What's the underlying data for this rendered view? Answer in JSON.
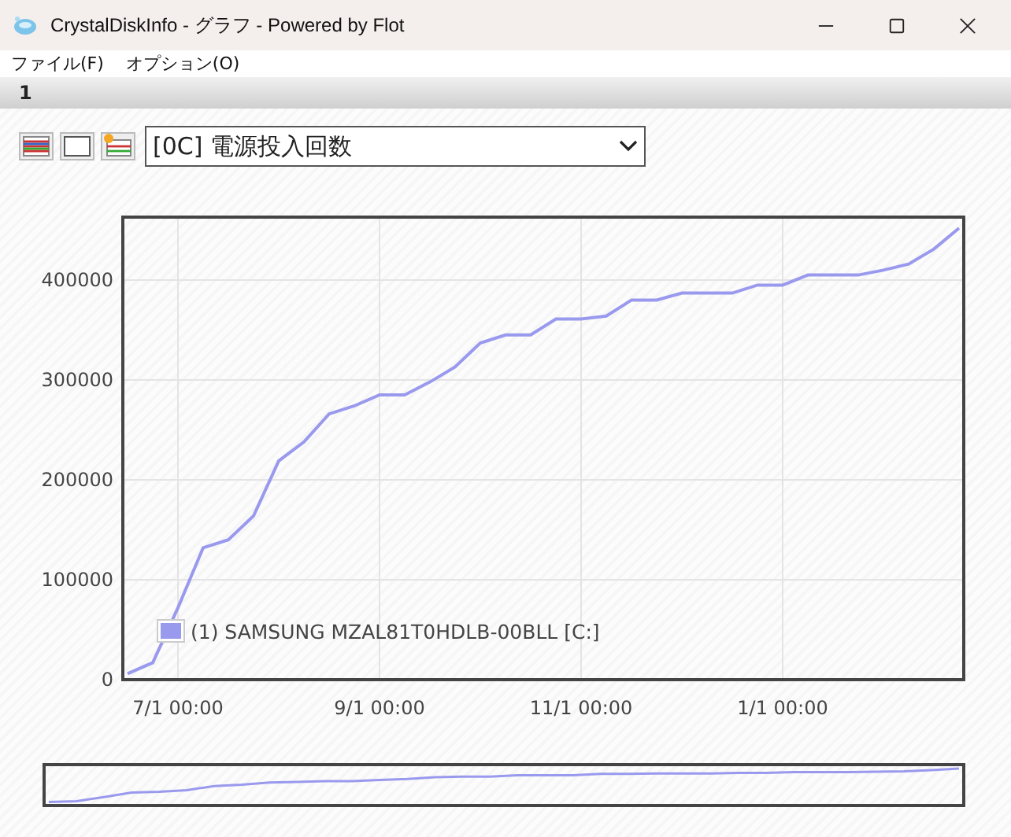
{
  "window": {
    "title": "CrystalDiskInfo - グラフ - Powered by Flot"
  },
  "menu": [
    {
      "label": "ファイル(F)"
    },
    {
      "label": "オプション(O)"
    }
  ],
  "tabs": [
    {
      "label": "1",
      "selected": true
    }
  ],
  "toolbar": {
    "attribute": "[0C] 電源投入回数"
  },
  "chart_data": {
    "type": "line",
    "categories": [
      null,
      null,
      "7/1 00:00",
      null,
      null,
      null,
      null,
      null,
      null,
      null,
      "9/1 00:00",
      null,
      null,
      null,
      null,
      null,
      null,
      null,
      "11/1 00:00",
      null,
      null,
      null,
      null,
      null,
      null,
      null,
      "1/1 00:00",
      null,
      null,
      null,
      null,
      null,
      null,
      null
    ],
    "series": [
      {
        "name": "(1) SAMSUNG MZAL81T0HDLB-00BLL [C:]",
        "color": "#9999ee",
        "values": [
          6000,
          17000,
          72000,
          132000,
          140000,
          164000,
          219000,
          238000,
          266000,
          274000,
          285000,
          285000,
          298000,
          313000,
          337000,
          345000,
          345000,
          361000,
          361000,
          364000,
          380000,
          380000,
          387000,
          387000,
          387000,
          395000,
          395000,
          405000,
          405000,
          405000,
          410000,
          416000,
          431000,
          452000
        ]
      }
    ],
    "ylim": [
      0,
      463000
    ],
    "grid": true,
    "yticks": [
      0,
      100000,
      200000,
      300000,
      400000
    ]
  }
}
